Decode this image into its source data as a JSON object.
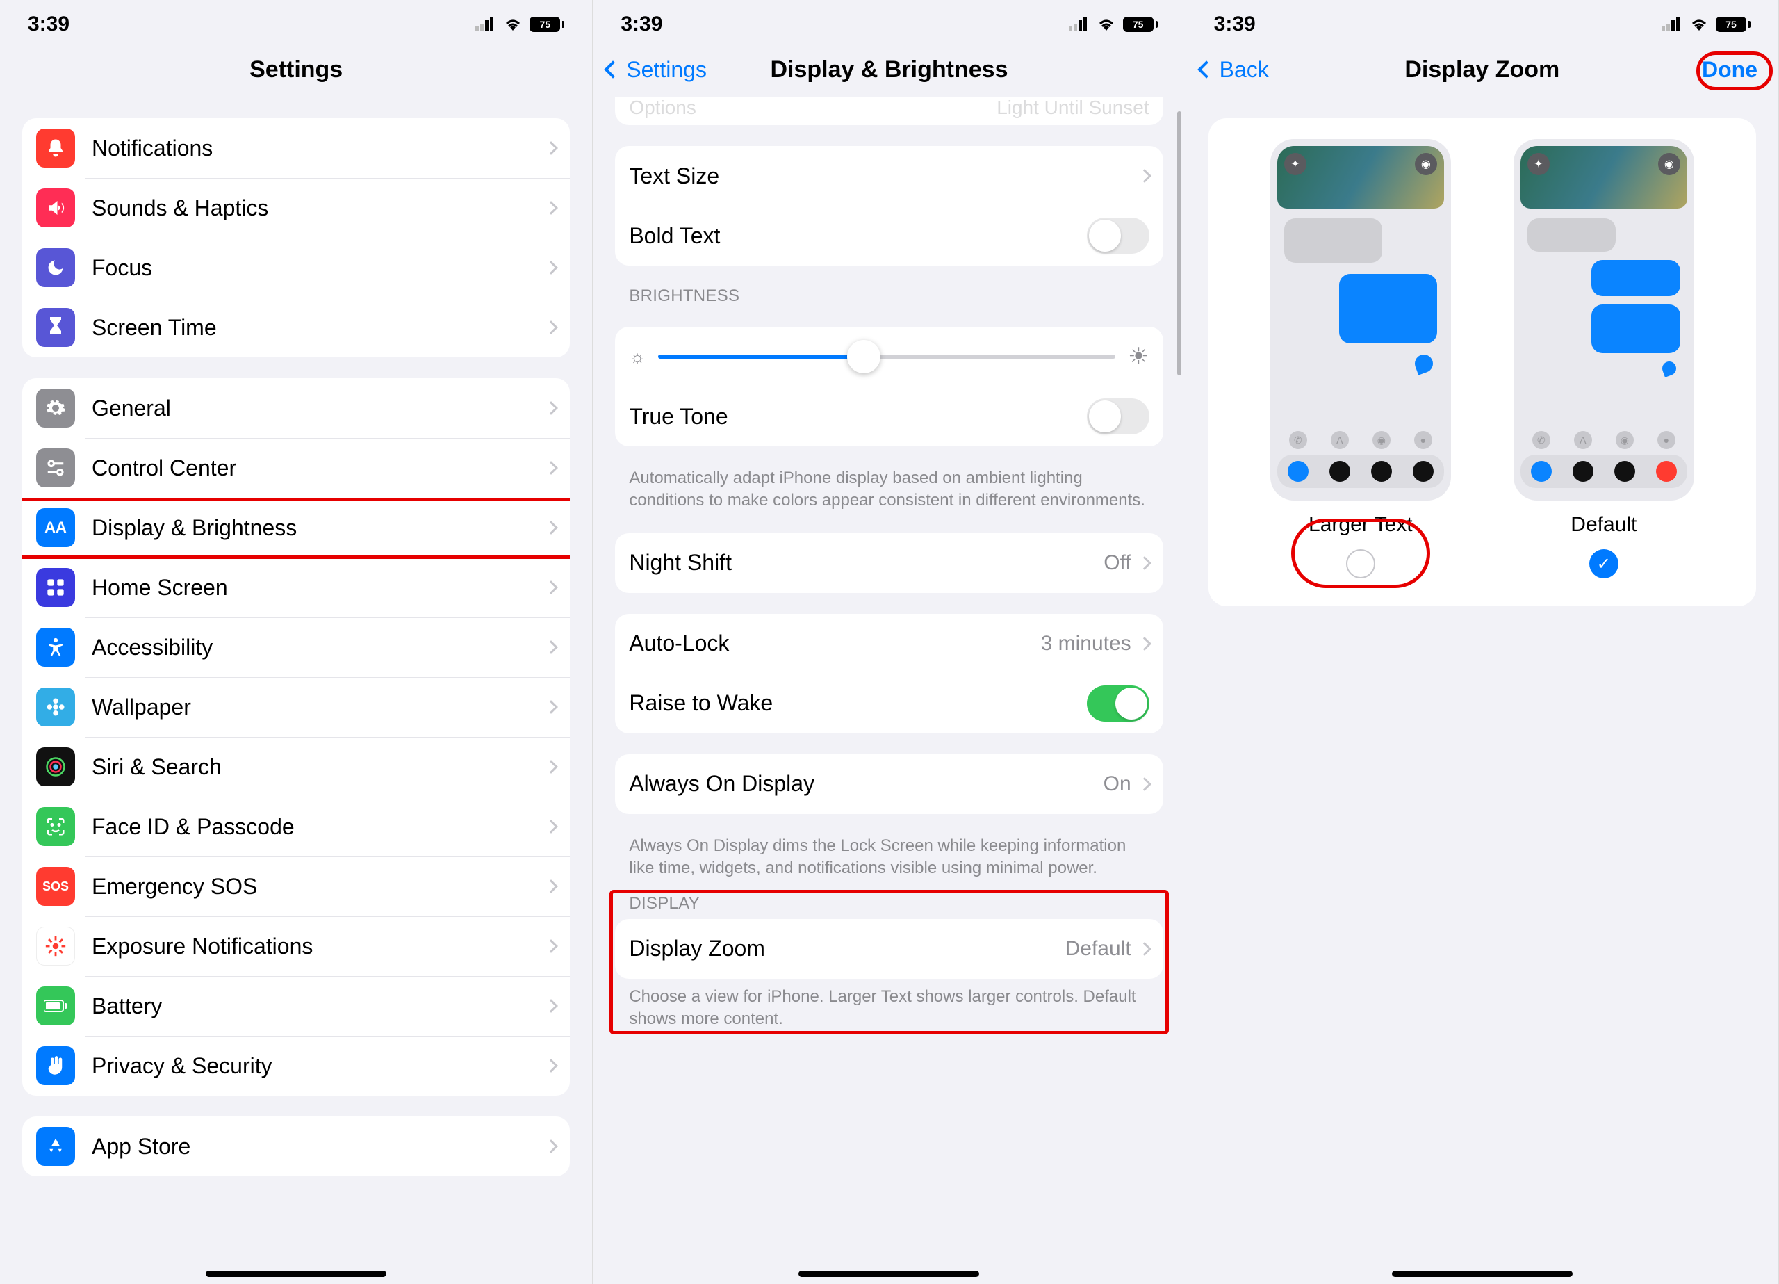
{
  "status": {
    "time": "3:39",
    "battery": "75"
  },
  "pane1": {
    "title": "Settings",
    "group1": [
      {
        "name": "notifications",
        "label": "Notifications",
        "color": "red"
      },
      {
        "name": "sounds",
        "label": "Sounds & Haptics",
        "color": "pink"
      },
      {
        "name": "focus",
        "label": "Focus",
        "color": "indigo"
      },
      {
        "name": "screen-time",
        "label": "Screen Time",
        "color": "indigo"
      }
    ],
    "group2": [
      {
        "name": "general",
        "label": "General",
        "color": "grey"
      },
      {
        "name": "control-center",
        "label": "Control Center",
        "color": "grey"
      },
      {
        "name": "display-brightness",
        "label": "Display & Brightness",
        "color": "blue",
        "highlight": true
      },
      {
        "name": "home-screen",
        "label": "Home Screen",
        "color": "indigo"
      },
      {
        "name": "accessibility",
        "label": "Accessibility",
        "color": "blue"
      },
      {
        "name": "wallpaper",
        "label": "Wallpaper",
        "color": "cyan"
      },
      {
        "name": "siri",
        "label": "Siri & Search",
        "color": "black"
      },
      {
        "name": "faceid",
        "label": "Face ID & Passcode",
        "color": "green"
      },
      {
        "name": "sos",
        "label": "Emergency SOS",
        "color": "red",
        "icon_text": "SOS"
      },
      {
        "name": "exposure",
        "label": "Exposure Notifications",
        "color": "white"
      },
      {
        "name": "battery",
        "label": "Battery",
        "color": "green"
      },
      {
        "name": "privacy",
        "label": "Privacy & Security",
        "color": "blue"
      }
    ],
    "group3": [
      {
        "name": "app-store",
        "label": "App Store",
        "color": "blue"
      }
    ]
  },
  "pane2": {
    "back": "Settings",
    "title": "Display & Brightness",
    "partial_row": {
      "label": "Options",
      "value": "Light Until Sunset"
    },
    "text_group": {
      "text_size": "Text Size",
      "bold_text": "Bold Text",
      "bold_on": false
    },
    "brightness": {
      "header": "BRIGHTNESS",
      "true_tone": "True Tone",
      "true_tone_on": false,
      "footer": "Automatically adapt iPhone display based on ambient lighting conditions to make colors appear consistent in different environments."
    },
    "night_shift": {
      "label": "Night Shift",
      "value": "Off"
    },
    "autolock_group": {
      "autolock": "Auto-Lock",
      "autolock_value": "3 minutes",
      "raise": "Raise to Wake",
      "raise_on": true
    },
    "aod": {
      "label": "Always On Display",
      "value": "On",
      "footer": "Always On Display dims the Lock Screen while keeping information like time, widgets, and notifications visible using minimal power."
    },
    "display_zoom": {
      "header": "DISPLAY",
      "label": "Display Zoom",
      "value": "Default",
      "footer": "Choose a view for iPhone. Larger Text shows larger controls. Default shows more content."
    }
  },
  "pane3": {
    "back": "Back",
    "title": "Display Zoom",
    "done": "Done",
    "options": {
      "larger": "Larger Text",
      "default": "Default",
      "selected": "default"
    }
  }
}
